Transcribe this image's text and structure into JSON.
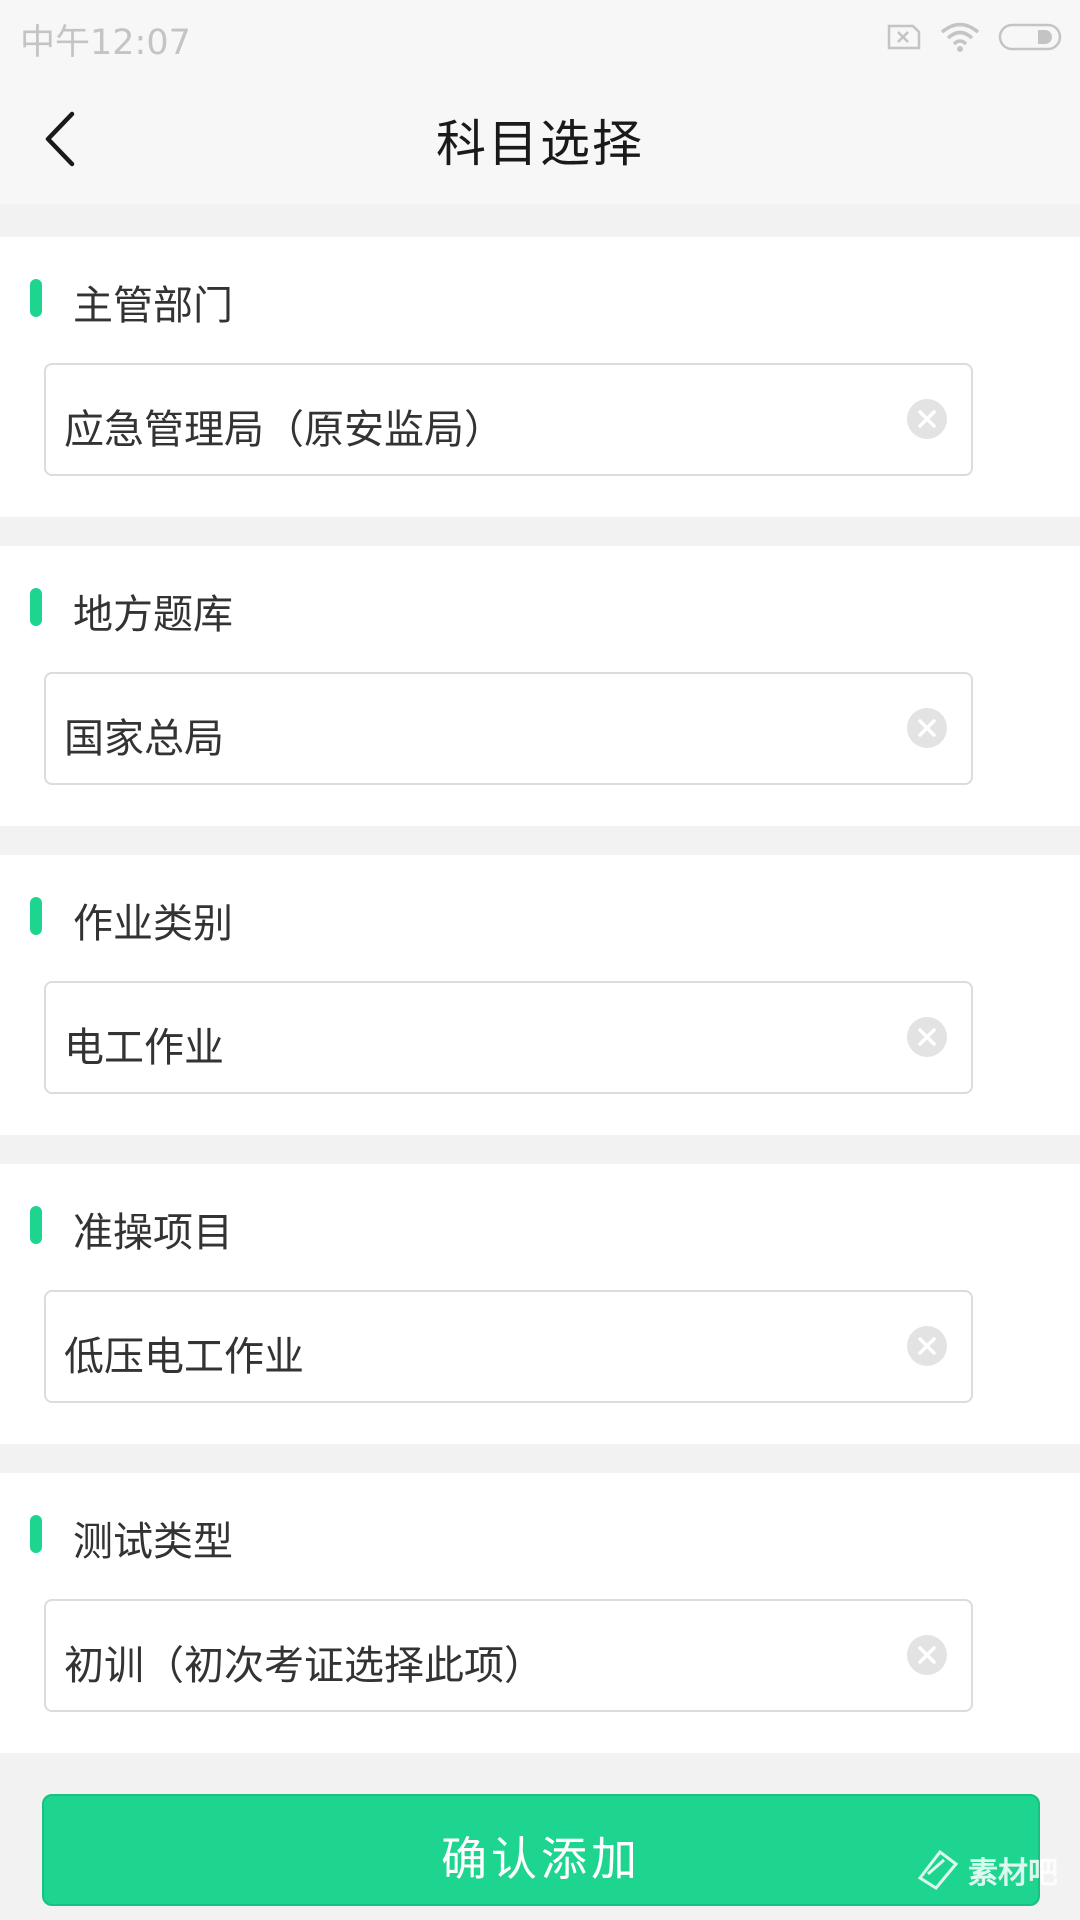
{
  "status_bar": {
    "time": "中午12:07",
    "icons": [
      "sim-x-icon",
      "wifi-icon",
      "battery-icon"
    ]
  },
  "header": {
    "title": "科目选择"
  },
  "sections": [
    {
      "label": "主管部门",
      "value": "应急管理局（原安监局）"
    },
    {
      "label": "地方题库",
      "value": "国家总局"
    },
    {
      "label": "作业类别",
      "value": "电工作业"
    },
    {
      "label": "准操项目",
      "value": "低压电工作业"
    },
    {
      "label": "测试类型",
      "value": "初训（初次考证选择此项）"
    }
  ],
  "confirm_button": {
    "label": "确认添加"
  },
  "colors": {
    "accent": "#1ed590",
    "background": "#f2f2f2",
    "field_border": "#dcdcdc"
  },
  "watermark": {
    "text": "素材吧"
  }
}
